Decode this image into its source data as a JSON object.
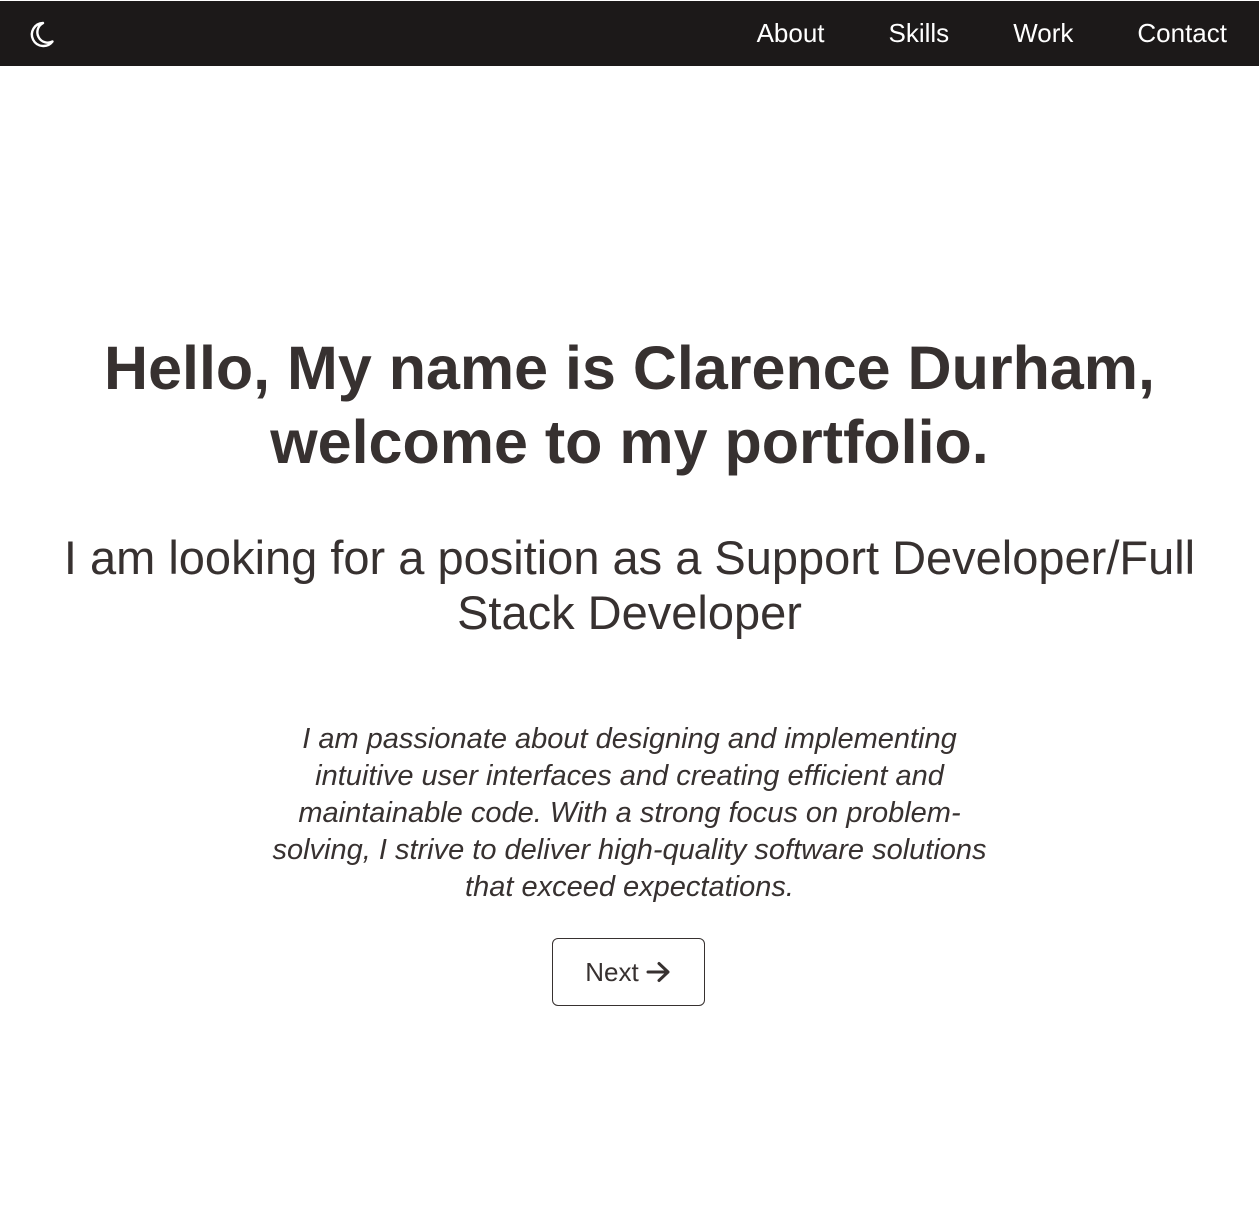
{
  "header": {
    "theme_toggle_icon": "crescent-moon-icon",
    "nav": [
      {
        "label": "About"
      },
      {
        "label": "Skills"
      },
      {
        "label": "Work"
      },
      {
        "label": "Contact"
      }
    ]
  },
  "hero": {
    "title": "Hello, My name is Clarence Durham, welcome to my portfolio.",
    "subtitle": "I am looking for a position as a Support Developer/Full Stack Developer",
    "description": "I am passionate about designing and implementing intuitive user interfaces and creating efficient and maintainable code. With a strong focus on problem-solving, I strive to deliver high-quality software solutions that exceed expectations.",
    "next_button": {
      "label": "Next",
      "icon": "arrow-right-icon"
    }
  },
  "colors": {
    "navbar_bg": "#1c1919",
    "nav_text": "#ffffff",
    "body_text": "#373130",
    "page_bg": "#ffffff"
  }
}
